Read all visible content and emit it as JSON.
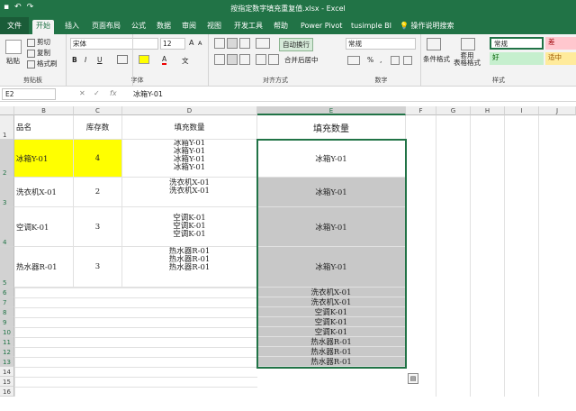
{
  "titlebar": {
    "title": "按指定数字填充重复值.xlsx - Excel"
  },
  "tabs": [
    "文件",
    "开始",
    "插入",
    "页面布局",
    "公式",
    "数据",
    "审阅",
    "视图",
    "开发工具",
    "帮助",
    "Power Pivot",
    "tusimple BI",
    "操作说明搜索"
  ],
  "ribbon": {
    "clipboard": {
      "paste": "粘贴",
      "cut": "剪切",
      "copy": "复制",
      "format_painter": "格式刷",
      "label": "剪贴板"
    },
    "font": {
      "name": "宋体",
      "size": "12",
      "label": "字体",
      "bold": "B",
      "italic": "I",
      "underline": "U",
      "grow": "A",
      "shrink": "A",
      "font_color": "A",
      "wen": "文"
    },
    "alignment": {
      "wrap": "自动换行",
      "merge": "合并后居中",
      "label": "对齐方式"
    },
    "number": {
      "format": "常规",
      "percent": "%",
      "comma": ",",
      "label": "数字"
    },
    "styles": {
      "conditional": "条件格式",
      "table": "套用\n表格格式",
      "normal": "常规",
      "bad": "差",
      "good": "好",
      "neutral": "适中",
      "label": "样式"
    },
    "colors": {
      "good_bg": "#c6efce",
      "bad_bg": "#ffc7ce",
      "neutral_bg": "#ffeb9c"
    }
  },
  "formula_bar": {
    "name_box": "E2",
    "fx": "fx",
    "value": "冰箱Y-01"
  },
  "columns": [
    "B",
    "C",
    "D",
    "E",
    "F",
    "G",
    "H",
    "I",
    "J"
  ],
  "rows": [
    "1",
    "2",
    "3",
    "4",
    "5",
    "6",
    "7",
    "8",
    "9",
    "10",
    "11",
    "12",
    "13",
    "14",
    "15",
    "16"
  ],
  "headers": {
    "b": "品名",
    "c": "库存数",
    "d": "填充数量",
    "e": "填充数量"
  },
  "data_rows": [
    {
      "name": "冰箱Y-01",
      "qty": "4",
      "fill": [
        "冰箱Y-01",
        "冰箱Y-01",
        "冰箱Y-01",
        "冰箱Y-01"
      ],
      "e": "冰箱Y-01"
    },
    {
      "name": "洗衣机X-01",
      "qty": "2",
      "fill": [
        "洗衣机X-01",
        "洗衣机X-01"
      ],
      "e": "冰箱Y-01"
    },
    {
      "name": "空调K-01",
      "qty": "3",
      "fill": [
        "空调K-01",
        "空调K-01",
        "空调K-01"
      ],
      "e": "冰箱Y-01"
    },
    {
      "name": "热水器R-01",
      "qty": "3",
      "fill": [
        "热水器R-01",
        "热水器R-01",
        "热水器R-01"
      ],
      "e": "冰箱Y-01"
    }
  ],
  "e_rows_6_13": [
    "洗衣机X-01",
    "洗衣机X-01",
    "空调K-01",
    "空调K-01",
    "空调K-01",
    "热水器R-01",
    "热水器R-01",
    "热水器R-01"
  ],
  "icons": {
    "undo": "↶",
    "redo": "↷",
    "save": "▪",
    "cancel": "✕",
    "confirm": "✓",
    "smart_tag": "▤",
    "search": "💡"
  }
}
